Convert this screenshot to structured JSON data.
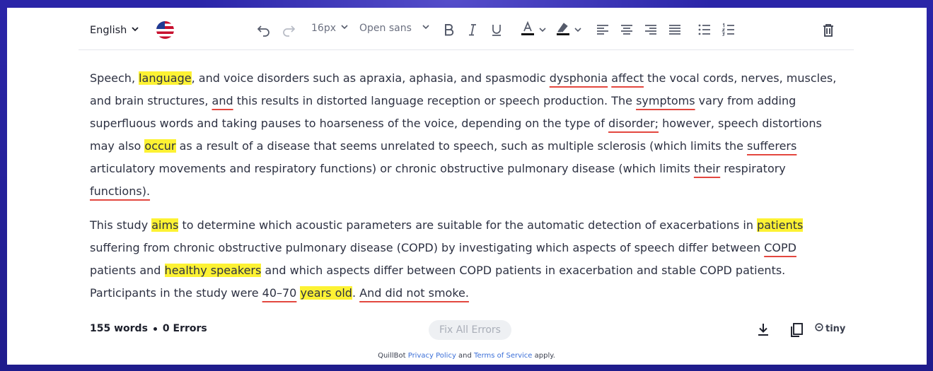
{
  "toolbar": {
    "language": "English",
    "font_size": "16px",
    "font_family": "Open sans"
  },
  "colors": {
    "highlight": "#fdf233",
    "error_underline": "#e3473f",
    "link": "#3b6fd8",
    "background": "#1f1c8c"
  },
  "icons": [
    "chevron-down-icon",
    "us-flag-icon",
    "undo-icon",
    "redo-icon",
    "bold-icon",
    "italic-icon",
    "underline-icon",
    "text-color-icon",
    "highlight-color-icon",
    "align-left-icon",
    "align-center-icon",
    "align-right-icon",
    "align-justify-icon",
    "bullet-list-icon",
    "numbered-list-icon",
    "trash-icon",
    "download-icon",
    "copy-icon",
    "tiny-logo-icon"
  ],
  "document": {
    "paragraphs": [
      [
        {
          "text": "Speech, "
        },
        {
          "text": "language",
          "style": "hl"
        },
        {
          "text": ", and voice disorders such as apraxia, aphasia, and spasmodic "
        },
        {
          "text": "dysphonia",
          "style": "ul"
        },
        {
          "text": " "
        },
        {
          "text": "affect",
          "style": "ul"
        },
        {
          "text": " the vocal cords, nerves, muscles, and brain structures, "
        },
        {
          "text": "and",
          "style": "ul"
        },
        {
          "text": " this results in distorted language reception or speech production. The "
        },
        {
          "text": "symptoms",
          "style": "ul"
        },
        {
          "text": " vary from adding superfluous words and taking pauses to hoarseness of the voice, depending on the type of "
        },
        {
          "text": "disorder;",
          "style": "ul"
        },
        {
          "text": " however, speech distortions may also "
        },
        {
          "text": "occur",
          "style": "hl"
        },
        {
          "text": " as a result of a disease that seems unrelated to speech, such as multiple sclerosis (which limits the "
        },
        {
          "text": "sufferers",
          "style": "ul"
        },
        {
          "text": " articulatory movements and respiratory functions) or chronic obstructive pulmonary disease (which limits "
        },
        {
          "text": "their",
          "style": "ul"
        },
        {
          "text": " respiratory "
        },
        {
          "text": "functions).",
          "style": "ul"
        }
      ],
      [
        {
          "text": "This study "
        },
        {
          "text": "aims",
          "style": "hl"
        },
        {
          "text": " to determine which acoustic parameters are suitable for the automatic detection of exacerbations in "
        },
        {
          "text": "patients",
          "style": "hl"
        },
        {
          "text": " suffering from chronic obstructive pulmonary disease (COPD) by investigating which aspects of speech differ between "
        },
        {
          "text": "COPD",
          "style": "ul"
        },
        {
          "text": " patients and "
        },
        {
          "text": "healthy speakers",
          "style": "hl"
        },
        {
          "text": " and which aspects differ between COPD patients in exacerbation and stable COPD patients. Participants in the study were "
        },
        {
          "text": "40–70",
          "style": "ul"
        },
        {
          "text": " "
        },
        {
          "text": "years old",
          "style": "hl"
        },
        {
          "text": ". "
        },
        {
          "text": "And did not smoke.",
          "style": "ul"
        }
      ]
    ]
  },
  "footer": {
    "word_count": "155 words",
    "errors": "0 Errors",
    "fix_all_label": "Fix All Errors",
    "brand": "tiny"
  },
  "legal": {
    "prefix": "QuillBot ",
    "privacy": "Privacy Policy",
    "and": " and ",
    "terms": "Terms of Service",
    "suffix": " apply."
  }
}
